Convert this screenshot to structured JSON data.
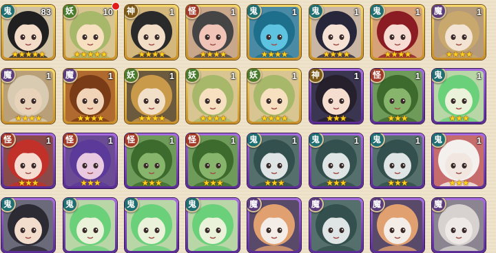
{
  "faction_colors": {
    "鬼": "#1f6e72",
    "妖": "#4a7b2c",
    "神": "#7d5a18",
    "怪": "#a23a2a",
    "魔": "#5b3c7c"
  },
  "cards": [
    {
      "faction": "鬼",
      "count": "83",
      "frame": "gold",
      "stars": "★★★★★",
      "skin": "#f3dcc8",
      "hair": "#202020",
      "bg": "#cfc1a4",
      "icon": "black-haired-maiden-portrait-icon"
    },
    {
      "faction": "妖",
      "count": "10",
      "frame": "gold",
      "stars": "★★★★★",
      "skin": "#f6e0c0",
      "hair": "#a7b86a",
      "bg": "#d8c592",
      "icon": "green-haired-girl-portrait-icon",
      "notification": true
    },
    {
      "faction": "神",
      "count": "1",
      "frame": "gold",
      "stars": "★★★★",
      "skin": "#f2ddc7",
      "hair": "#2a2a2a",
      "bg": "#d4b77c",
      "icon": "dark-haired-fox-portrait-icon"
    },
    {
      "faction": "怪",
      "count": "1",
      "frame": "gold",
      "stars": "★★★★",
      "skin": "#f1c4b8",
      "hair": "#454545",
      "bg": "#c8a78b",
      "icon": "pig-masked-portrait-icon"
    },
    {
      "faction": "鬼",
      "count": "1",
      "frame": "gold",
      "stars": "★★★★",
      "skin": "#5ec3e0",
      "hair": "#1e6f8c",
      "bg": "#4a8aa4",
      "icon": "blue-spirit-portrait-icon"
    },
    {
      "faction": "鬼",
      "count": "1",
      "frame": "gold",
      "stars": "★★★★",
      "skin": "#f5e2d4",
      "hair": "#27263a",
      "bg": "#c9b6a4",
      "icon": "teal-eyed-girl-portrait-icon"
    },
    {
      "faction": "鬼",
      "count": "1",
      "frame": "gold",
      "stars": "★★★★",
      "skin": "#f6dcd3",
      "hair": "#8b1c24",
      "bg": "#d7a27a",
      "icon": "red-crowned-girl-portrait-icon"
    },
    {
      "faction": "魔",
      "count": "1",
      "frame": "gold",
      "stars": "★★★★",
      "skin": "#f2e3d2",
      "hair": "#c8a86c",
      "bg": "#b59b7a",
      "icon": "gold-crowned-sage-portrait-icon"
    },
    {
      "faction": "魔",
      "count": "1",
      "frame": "gold",
      "stars": "★★★★",
      "skin": "#e8d2b9",
      "hair": "#d8cbb2",
      "bg": "#b9a079",
      "icon": "silver-haired-elder-portrait-icon"
    },
    {
      "faction": "魔",
      "count": "1",
      "frame": "gold",
      "stars": "★★★★",
      "skin": "#f1d3b8",
      "hair": "#7a3b17",
      "bg": "#b06a30",
      "icon": "brown-haired-girl-portrait-icon"
    },
    {
      "faction": "妖",
      "count": "1",
      "frame": "gold",
      "stars": "★★★★",
      "skin": "#f2dfc8",
      "hair": "#c99a4a",
      "bg": "#6b5a3e",
      "icon": "orange-lion-portrait-icon"
    },
    {
      "faction": "妖",
      "count": "1",
      "frame": "gold",
      "stars": "★★★★",
      "skin": "#f6e0c0",
      "hair": "#a7b86a",
      "bg": "#d8c592",
      "icon": "green-haired-girl-portrait-icon"
    },
    {
      "faction": "妖",
      "count": "1",
      "frame": "gold",
      "stars": "★★★★",
      "skin": "#f6e0c0",
      "hair": "#a7b86a",
      "bg": "#d8c592",
      "icon": "green-haired-girl-portrait-icon"
    },
    {
      "faction": "神",
      "count": "1",
      "frame": "purple",
      "stars": "★★★",
      "skin": "#f5ddd0",
      "hair": "#25202c",
      "bg": "#3a3550",
      "icon": "black-cat-ear-girl-portrait-icon"
    },
    {
      "faction": "怪",
      "count": "1",
      "frame": "purple",
      "stars": "★★★",
      "skin": "#87b56b",
      "hair": "#3d6b2e",
      "bg": "#6e9a5a",
      "icon": "green-owl-portrait-icon"
    },
    {
      "faction": "鬼",
      "count": "1",
      "frame": "purple",
      "stars": "★★★",
      "skin": "#eaf3d9",
      "hair": "#6ad07a",
      "bg": "#b9d6a7",
      "icon": "green-cat-girl-portrait-icon"
    },
    {
      "faction": "怪",
      "count": "1",
      "frame": "purple",
      "stars": "★★★",
      "skin": "#f6dcd0",
      "hair": "#c2302a",
      "bg": "#8a4a4a",
      "icon": "red-haired-girl-portrait-icon"
    },
    {
      "faction": "怪",
      "count": "1",
      "frame": "purple",
      "stars": "★★★",
      "skin": "#e8c9e0",
      "hair": "#5b3a9a",
      "bg": "#6b4c94",
      "icon": "purple-haired-girl-portrait-icon"
    },
    {
      "faction": "怪",
      "count": "1",
      "frame": "purple",
      "stars": "★★★",
      "skin": "#87b56b",
      "hair": "#3d6b2e",
      "bg": "#6e9a5a",
      "icon": "green-owl-portrait-icon"
    },
    {
      "faction": "怪",
      "count": "1",
      "frame": "purple",
      "stars": "★★★",
      "skin": "#87b56b",
      "hair": "#3d6b2e",
      "bg": "#6e9a5a",
      "icon": "green-owl-portrait-icon"
    },
    {
      "faction": "鬼",
      "count": "1",
      "frame": "purple",
      "stars": "★★★",
      "skin": "#dfe4e4",
      "hair": "#33504e",
      "bg": "#55706c",
      "icon": "skull-mask-portrait-icon"
    },
    {
      "faction": "鬼",
      "count": "1",
      "frame": "purple",
      "stars": "★★★",
      "skin": "#dfe4e4",
      "hair": "#33504e",
      "bg": "#55706c",
      "icon": "skull-mask-portrait-icon"
    },
    {
      "faction": "鬼",
      "count": "1",
      "frame": "purple",
      "stars": "★★★",
      "skin": "#dfe4e4",
      "hair": "#33504e",
      "bg": "#55706c",
      "icon": "skull-mask-portrait-icon"
    },
    {
      "faction": "鬼",
      "count": "1",
      "frame": "purple",
      "stars": "★★★",
      "skin": "#f1e6e0",
      "hair": "#f4f0ee",
      "bg": "#c66c6c",
      "icon": "white-hooded-girl-portrait-icon"
    },
    {
      "faction": "鬼",
      "count": "",
      "frame": "purple",
      "stars": "",
      "skin": "#f2dccc",
      "hair": "#2c2a33",
      "bg": "#6a6a7a",
      "icon": "black-hat-girl-portrait-icon"
    },
    {
      "faction": "鬼",
      "count": "",
      "frame": "purple",
      "stars": "",
      "skin": "#eaf3d9",
      "hair": "#6ad07a",
      "bg": "#b9d6a7",
      "icon": "green-cat-girl-portrait-icon"
    },
    {
      "faction": "鬼",
      "count": "",
      "frame": "purple",
      "stars": "",
      "skin": "#eaf3d9",
      "hair": "#6ad07a",
      "bg": "#b9d6a7",
      "icon": "green-cat-girl-portrait-icon"
    },
    {
      "faction": "鬼",
      "count": "",
      "frame": "purple",
      "stars": "",
      "skin": "#eaf3d9",
      "hair": "#6ad07a",
      "bg": "#b9d6a7",
      "icon": "green-cat-girl-portrait-icon"
    },
    {
      "faction": "魔",
      "count": "",
      "frame": "purple",
      "stars": "",
      "skin": "#f4ece6",
      "hair": "#e0a070",
      "bg": "#5a4a6a",
      "icon": "fox-mask-portrait-icon"
    },
    {
      "faction": "魔",
      "count": "",
      "frame": "purple",
      "stars": "",
      "skin": "#dfe4e4",
      "hair": "#33504e",
      "bg": "#55706c",
      "icon": "skull-mask-portrait-icon"
    },
    {
      "faction": "魔",
      "count": "",
      "frame": "purple",
      "stars": "",
      "skin": "#f4ece6",
      "hair": "#e0a070",
      "bg": "#5a4a6a",
      "icon": "fox-mask-portrait-icon"
    },
    {
      "faction": "魔",
      "count": "",
      "frame": "purple",
      "stars": "",
      "skin": "#eee9e6",
      "hair": "#d7d2cf",
      "bg": "#8a8590",
      "icon": "white-haired-elder-portrait-icon"
    }
  ]
}
